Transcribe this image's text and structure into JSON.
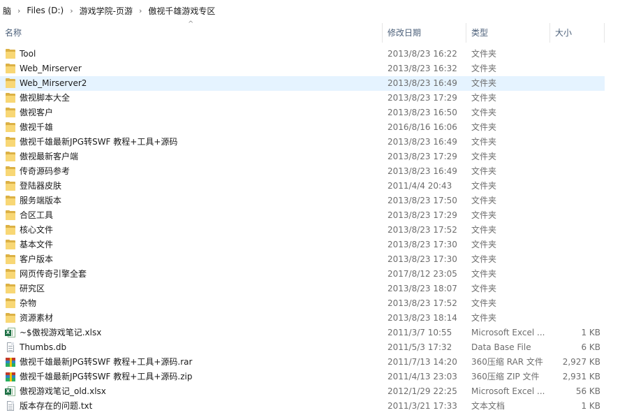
{
  "breadcrumb": {
    "items": [
      "脑",
      "Files (D:)",
      "游戏学院-页游",
      "傲视千雄游戏专区"
    ],
    "separator": "›"
  },
  "columns": {
    "name": "名称",
    "date": "修改日期",
    "type": "类型",
    "size": "大小",
    "sort_indicator": "^"
  },
  "files": [
    {
      "name": "Tool",
      "date": "2013/8/23 16:22",
      "type": "文件夹",
      "size": "",
      "icon": "folder-icon"
    },
    {
      "name": "Web_Mirserver",
      "date": "2013/8/23 16:32",
      "type": "文件夹",
      "size": "",
      "icon": "folder-icon"
    },
    {
      "name": "Web_Mirserver2",
      "date": "2013/8/23 16:49",
      "type": "文件夹",
      "size": "",
      "icon": "folder-icon",
      "selected": true
    },
    {
      "name": "傲视脚本大全",
      "date": "2013/8/23 17:29",
      "type": "文件夹",
      "size": "",
      "icon": "folder-icon"
    },
    {
      "name": "傲视客户",
      "date": "2013/8/23 16:50",
      "type": "文件夹",
      "size": "",
      "icon": "folder-icon"
    },
    {
      "name": "傲视千雄",
      "date": "2016/8/16 16:06",
      "type": "文件夹",
      "size": "",
      "icon": "folder-icon"
    },
    {
      "name": "傲视千雄最新JPG转SWF 教程+工具+源码",
      "date": "2013/8/23 16:49",
      "type": "文件夹",
      "size": "",
      "icon": "folder-icon"
    },
    {
      "name": "傲视最新客户端",
      "date": "2013/8/23 17:29",
      "type": "文件夹",
      "size": "",
      "icon": "folder-icon"
    },
    {
      "name": "传奇源码参考",
      "date": "2013/8/23 16:49",
      "type": "文件夹",
      "size": "",
      "icon": "folder-icon"
    },
    {
      "name": "登陆器皮肤",
      "date": "2011/4/4 20:43",
      "type": "文件夹",
      "size": "",
      "icon": "folder-icon"
    },
    {
      "name": "服务端版本",
      "date": "2013/8/23 17:50",
      "type": "文件夹",
      "size": "",
      "icon": "folder-icon"
    },
    {
      "name": "合区工具",
      "date": "2013/8/23 17:29",
      "type": "文件夹",
      "size": "",
      "icon": "folder-icon"
    },
    {
      "name": "核心文件",
      "date": "2013/8/23 17:52",
      "type": "文件夹",
      "size": "",
      "icon": "folder-icon"
    },
    {
      "name": "基本文件",
      "date": "2013/8/23 17:30",
      "type": "文件夹",
      "size": "",
      "icon": "folder-icon"
    },
    {
      "name": "客户版本",
      "date": "2013/8/23 17:30",
      "type": "文件夹",
      "size": "",
      "icon": "folder-icon"
    },
    {
      "name": "网页传奇引擎全套",
      "date": "2017/8/12 23:05",
      "type": "文件夹",
      "size": "",
      "icon": "folder-icon"
    },
    {
      "name": "研究区",
      "date": "2013/8/23 18:07",
      "type": "文件夹",
      "size": "",
      "icon": "folder-icon"
    },
    {
      "name": "杂物",
      "date": "2013/8/23 17:52",
      "type": "文件夹",
      "size": "",
      "icon": "folder-icon"
    },
    {
      "name": "资源素材",
      "date": "2013/8/23 18:14",
      "type": "文件夹",
      "size": "",
      "icon": "folder-icon"
    },
    {
      "name": "~$傲视游戏笔记.xlsx",
      "date": "2011/3/7 10:55",
      "type": "Microsoft Excel ...",
      "size": "1 KB",
      "icon": "excel-file-icon"
    },
    {
      "name": "Thumbs.db",
      "date": "2011/5/3 17:32",
      "type": "Data Base File",
      "size": "6 KB",
      "icon": "document-file-icon"
    },
    {
      "name": "傲视千雄最新JPG转SWF 教程+工具+源码.rar",
      "date": "2011/7/13 14:20",
      "type": "360压缩 RAR 文件",
      "size": "2,927 KB",
      "icon": "archive-file-icon"
    },
    {
      "name": "傲视千雄最新JPG转SWF 教程+工具+源码.zip",
      "date": "2011/4/13 23:03",
      "type": "360压缩 ZIP 文件",
      "size": "2,931 KB",
      "icon": "archive-file-icon"
    },
    {
      "name": "傲视游戏笔记_old.xlsx",
      "date": "2012/1/29 22:25",
      "type": "Microsoft Excel ...",
      "size": "56 KB",
      "icon": "excel-file-icon"
    },
    {
      "name": "版本存在的问题.txt",
      "date": "2011/3/21 17:33",
      "type": "文本文档",
      "size": "1 KB",
      "icon": "document-file-icon"
    }
  ]
}
